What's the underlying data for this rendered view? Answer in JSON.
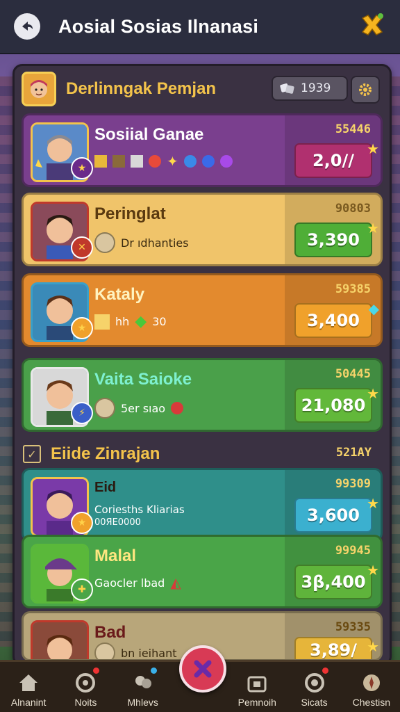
{
  "header": {
    "title": "Aosial Sosias Ilnanasi"
  },
  "panel": {
    "title": "Derlinngak Pemjan",
    "stat_value": "1939"
  },
  "cards": [
    {
      "name": "Sosiial Ganae",
      "sub": "",
      "code": "55446",
      "value": "2,0//",
      "color": "#7a3f8e",
      "value_color": "#b0306f"
    },
    {
      "name": "Peringlat",
      "sub": "Dr ıdhanties",
      "code": "90803",
      "value": "3,390",
      "color": "#f0c46a",
      "value_color": "#4fae37"
    },
    {
      "name": "Kataly",
      "sub": "hh",
      "sub2": "30",
      "code": "59385",
      "value": "3,400",
      "color": "#e38a2e",
      "value_color": "#f0a12b"
    },
    {
      "name": "Vaita Saioke",
      "sub": "5er sıao",
      "code": "50445",
      "value": "21,080",
      "color": "#4aa04a",
      "value_color": "#62b83a"
    }
  ],
  "section": {
    "title": "Eiide Zinrajan",
    "code": "521AY"
  },
  "section_cards": [
    {
      "name": "Eid",
      "sub": "Coriesths Kliarias",
      "sub2": "00ЯЕ0000",
      "code": "99309",
      "value": "3,600",
      "color": "#2f8f8a",
      "value_color": "#3bb0cf"
    },
    {
      "name": "Malal",
      "sub": "Gaocler lbad",
      "code": "99945",
      "value": "3β,400",
      "color": "#4aa548",
      "value_color": "#5fb43b"
    },
    {
      "name": "Bad",
      "sub": "bn ieihant",
      "code": "59335",
      "value": "3,89/",
      "color": "#b8a67a",
      "value_color": "#e6b53a"
    }
  ],
  "nav": [
    {
      "label": "Alnanint",
      "icon": "home-icon"
    },
    {
      "label": "Noits",
      "icon": "target-icon"
    },
    {
      "label": "Mhlevs",
      "icon": "people-icon"
    },
    {
      "label": "",
      "icon": "center-action-icon"
    },
    {
      "label": "Pemnoih",
      "icon": "chest-icon"
    },
    {
      "label": "Sicats",
      "icon": "stats-icon"
    },
    {
      "label": "Chestisn",
      "icon": "compass-icon"
    }
  ],
  "colors": {
    "accent": "#f3c34b",
    "topbar": "#2b2d3e",
    "panel": "#3a3142"
  }
}
